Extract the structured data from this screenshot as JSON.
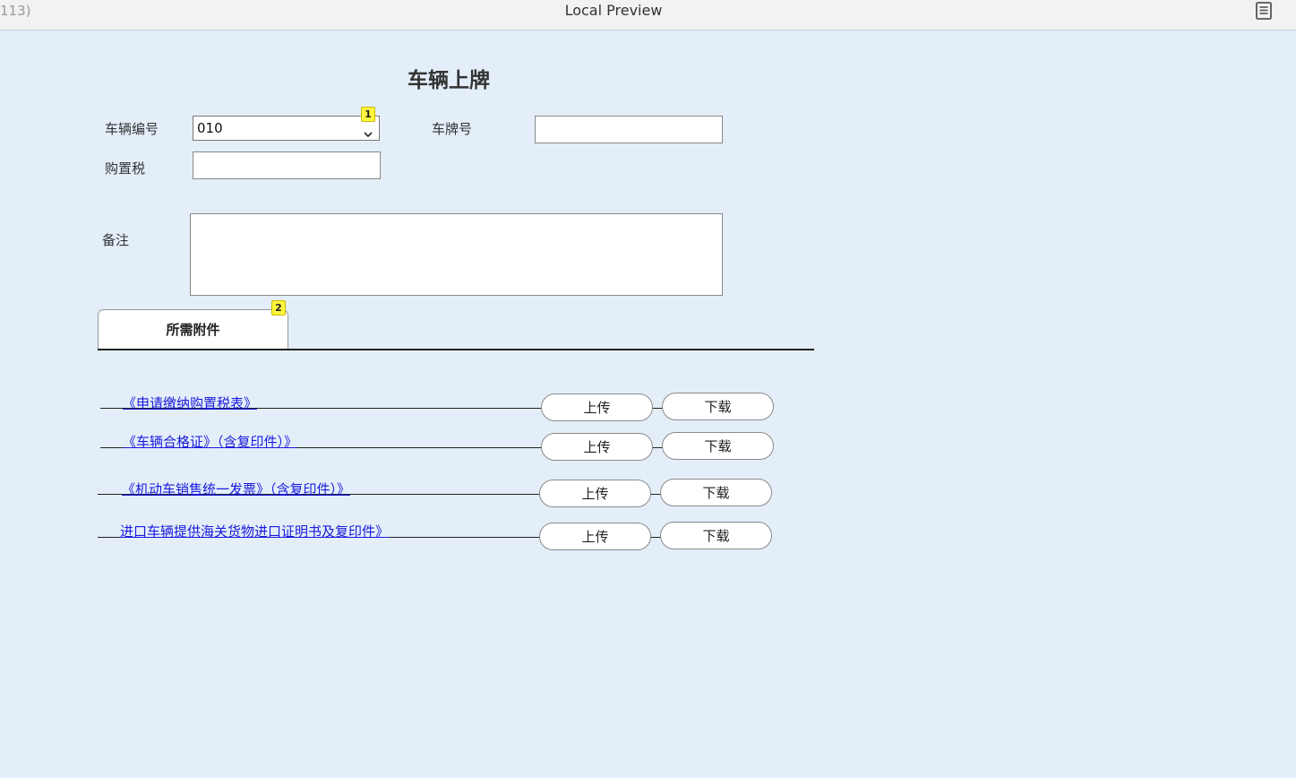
{
  "window": {
    "left_text": "113)",
    "title": "Local Preview",
    "menu_icon": "document-list-icon"
  },
  "form": {
    "title": "车辆上牌",
    "vehicle_id_label": "车辆编号",
    "vehicle_id_value": "010",
    "plate_label": "车牌号",
    "plate_value": "",
    "tax_label": "购置税",
    "tax_value": "",
    "remark_label": "备注",
    "remark_value": ""
  },
  "badges": {
    "select": "1",
    "tab": "2"
  },
  "tab": {
    "label": "所需附件"
  },
  "attachments": [
    {
      "name": "《申请缴纳购置税表》",
      "upload": "上传",
      "download": "下载"
    },
    {
      "name": "《车辆合格证》（含复印件）》",
      "upload": "上传",
      "download": "下载"
    },
    {
      "name": "《机动车销售统一发票》（含复印件）》",
      "upload": "上传",
      "download": "下载"
    },
    {
      "name": "进口车辆提供海关货物进口证明书及复印件》",
      "upload": "上传",
      "download": "下载"
    }
  ]
}
